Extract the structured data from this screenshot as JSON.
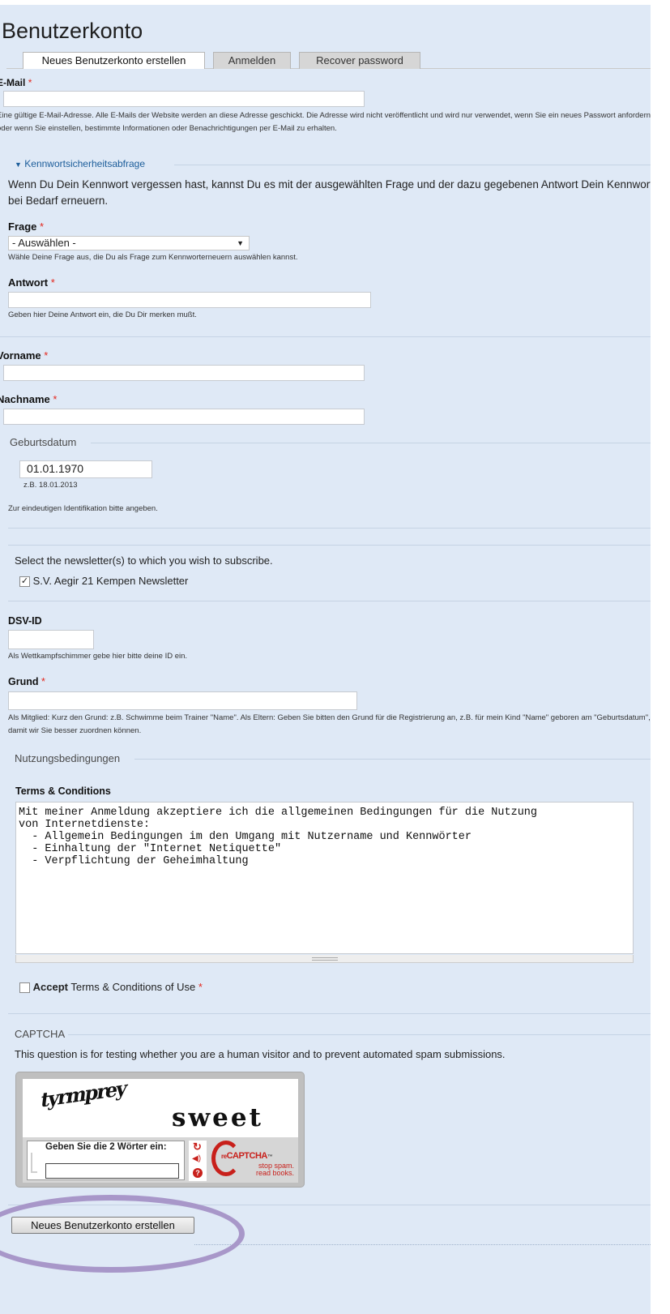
{
  "page": {
    "title": "Benutzerkonto"
  },
  "tabs": [
    {
      "label": "Neues Benutzerkonto erstellen",
      "active": true
    },
    {
      "label": "Anmelden",
      "active": false
    },
    {
      "label": "Recover password",
      "active": false
    }
  ],
  "required_marker": "*",
  "email": {
    "label": "E-Mail",
    "value": "",
    "description": "Eine gültige E-Mail-Adresse. Alle E-Mails der Website werden an diese Adresse geschickt. Die Adresse wird nicht veröffentlicht und wird nur verwendet, wenn Sie ein neues Passwort anfordern oder wenn Sie einstellen, bestimmte Informationen oder Benachrichtigungen per E-Mail zu erhalten."
  },
  "security": {
    "legend": "Kennwortsicherheitsabfrage",
    "toggle_icon": "triangle-down-icon",
    "intro": "Wenn Du Dein Kennwort vergessen hast, kannst Du es mit der ausgewählten Frage und der dazu gegebenen Antwort Dein Kennwort bei Bedarf erneuern.",
    "question_label": "Frage",
    "question_selected": "- Auswählen -",
    "question_description": "Wähle Deine Frage aus, die Du als Frage zum Kennworterneuern auswählen kannst.",
    "answer_label": "Antwort",
    "answer_value": "",
    "answer_description": "Geben hier Deine Antwort ein, die Du Dir merken mußt."
  },
  "firstname": {
    "label": "Vorname",
    "value": ""
  },
  "lastname": {
    "label": "Nachname",
    "value": ""
  },
  "birthdate": {
    "legend": "Geburtsdatum",
    "value": "01.01.1970",
    "example": "z.B. 18.01.2013",
    "description": "Zur eindeutigen Identifikation bitte angeben."
  },
  "newsletter": {
    "prompt": "Select the newsletter(s) to which you wish to subscribe.",
    "option_label": "S.V. Aegir 21 Kempen Newsletter",
    "checked": true
  },
  "dsv": {
    "label": "DSV-ID",
    "value": "",
    "description": "Als Wettkampfschimmer gebe hier bitte deine ID ein."
  },
  "reason": {
    "label": "Grund",
    "value": "",
    "description": "Als Mitglied: Kurz den Grund: z.B. Schwimme beim Trainer \"Name\". Als Eltern: Geben Sie bitten den Grund für die Registrierung an, z.B. für mein Kind \"Name\" geboren am \"Geburtsdatum\", damit wir Sie besser zuordnen können."
  },
  "terms": {
    "legend": "Nutzungsbedingungen",
    "label": "Terms & Conditions",
    "text": "Mit meiner Anmeldung akzeptiere ich die allgemeinen Bedingungen für die Nutzung\nvon Internetdienste:\n  - Allgemein Bedingungen im den Umgang mit Nutzername und Kennwörter\n  - Einhaltung der \"Internet Netiquette\"\n  - Verpflichtung der Geheimhaltung",
    "accept_bold": "Accept",
    "accept_rest": "Terms & Conditions of Use",
    "accepted": false
  },
  "captcha": {
    "legend": "CAPTCHA",
    "description": "This question is for testing whether you are a human visitor and to prevent automated spam submissions.",
    "word1": "tyrmprey",
    "word2": "sweet",
    "prompt": "Geben Sie die 2 Wörter ein:",
    "value": "",
    "brand_prefix": "re",
    "brand": "CAPTCHA",
    "brand_tm": "™",
    "tagline1": "stop spam.",
    "tagline2": "read books.",
    "icons": [
      "refresh-icon",
      "audio-icon",
      "help-icon"
    ]
  },
  "submit_label": "Neues Benutzerkonto erstellen",
  "colors": {
    "background": "#dfe9f6",
    "required": "#e4271d",
    "link": "#1c5d9a",
    "highlight_ring": "#a897c9"
  }
}
